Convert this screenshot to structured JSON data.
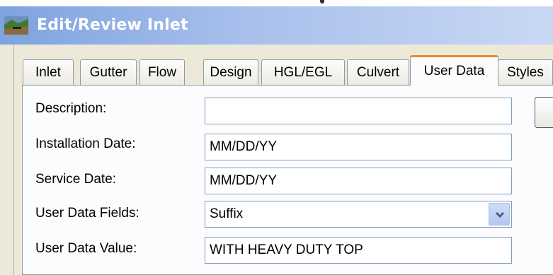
{
  "window": {
    "title": "Edit/Review Inlet",
    "icon": "inlet-app-icon"
  },
  "tabs": [
    {
      "label": "Inlet",
      "active": false
    },
    {
      "label": "Gutter",
      "active": false
    },
    {
      "label": "Flow",
      "active": false
    },
    {
      "label": "Design",
      "active": false
    },
    {
      "label": "HGL/EGL",
      "active": false
    },
    {
      "label": "Culvert",
      "active": false
    },
    {
      "label": "User Data",
      "active": true
    },
    {
      "label": "Styles",
      "active": false
    }
  ],
  "form": {
    "description": {
      "label": "Description:",
      "value": ""
    },
    "installation_date": {
      "label": "Installation Date:",
      "value": "MM/DD/YY"
    },
    "service_date": {
      "label": "Service Date:",
      "value": "MM/DD/YY"
    },
    "user_data_fields": {
      "label": "User Data Fields:",
      "value": "Suffix",
      "icon": "chevron-down-icon"
    },
    "user_data_value": {
      "label": "User Data Value:",
      "value": "WITH HEAVY DUTY TOP"
    }
  },
  "colors": {
    "title_bar_start": "#7ea3e0",
    "title_bar_end": "#c9d8f4",
    "active_tab_accent": "#e68b2c",
    "field_border": "#7f9db9",
    "dialog_background": "#ece9d8"
  }
}
